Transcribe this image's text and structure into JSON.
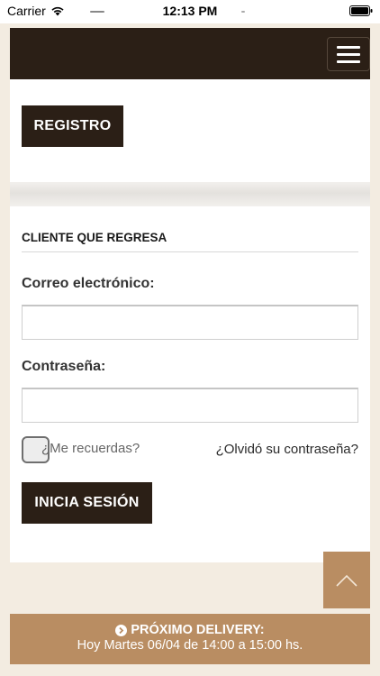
{
  "status_bar": {
    "carrier": "Carrier",
    "time": "12:13 PM",
    "icons": [
      "wifi-icon",
      "battery-icon"
    ]
  },
  "header": {
    "menu_icon": "hamburger-menu-icon",
    "background": "#2b1f16"
  },
  "register": {
    "button_label": "REGISTRO"
  },
  "login": {
    "title": "CLIENTE QUE REGRESA",
    "email_label": "Correo electrónico:",
    "email_value": "",
    "password_label": "Contraseña:",
    "password_value": "",
    "remember_label": "¿Me recuerdas?",
    "remember_checked": false,
    "forgot_link": "¿Olvidó su contraseña?",
    "submit_label": "INICIA SESIÓN"
  },
  "scroll_top": {
    "icon": "chevron-up-icon"
  },
  "footer": {
    "icon": "circle-chevron-right-icon",
    "title": "PRÓXIMO DELIVERY:",
    "detail": "Hoy Martes 06/04 de 14:00 a 15:00 hs."
  },
  "colors": {
    "dark_brown": "#2b1f16",
    "accent_tan": "#b98d62",
    "page_bg": "#f3ece1"
  }
}
